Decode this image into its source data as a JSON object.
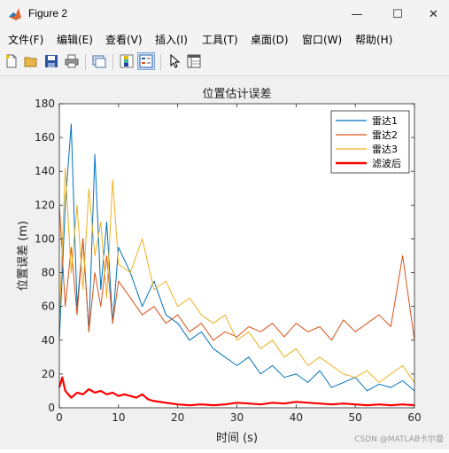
{
  "window": {
    "title": "Figure 2",
    "minimize": "—",
    "maximize": "☐",
    "close": "✕"
  },
  "menu": [
    "文件(F)",
    "编辑(E)",
    "查看(V)",
    "插入(I)",
    "工具(T)",
    "桌面(D)",
    "窗口(W)",
    "帮助(H)"
  ],
  "toolbar": [
    "new-figure-icon",
    "open-file-icon",
    "save-icon",
    "print-icon",
    "link-plot-icon",
    "colorbar-icon",
    "legend-icon",
    "pointer-icon",
    "property-inspector-icon"
  ],
  "watermark": "CSDN @MATLAB卡尔曼",
  "chart_data": {
    "type": "line",
    "title": "位置估计误差",
    "xlabel": "时间 (s)",
    "ylabel": "位置误差 (m)",
    "xlim": [
      0,
      60
    ],
    "ylim": [
      0,
      180
    ],
    "xticks": [
      0,
      10,
      20,
      30,
      40,
      50,
      60
    ],
    "yticks": [
      0,
      20,
      40,
      60,
      80,
      100,
      120,
      140,
      160,
      180
    ],
    "grid": false,
    "legend_position": "top-right",
    "series": [
      {
        "name": "雷达1",
        "color": "#0072BD",
        "x": [
          0,
          1,
          2,
          3,
          4,
          5,
          6,
          7,
          8,
          9,
          10,
          12,
          14,
          16,
          18,
          20,
          22,
          24,
          26,
          28,
          30,
          32,
          34,
          36,
          38,
          40,
          42,
          44,
          46,
          48,
          50,
          52,
          54,
          56,
          58,
          60
        ],
        "y": [
          40,
          120,
          168,
          60,
          100,
          45,
          150,
          70,
          110,
          50,
          95,
          80,
          60,
          75,
          55,
          50,
          40,
          45,
          35,
          30,
          25,
          30,
          20,
          25,
          18,
          20,
          15,
          22,
          12,
          15,
          18,
          10,
          14,
          12,
          16,
          10
        ]
      },
      {
        "name": "雷达2",
        "color": "#D95319",
        "x": [
          0,
          1,
          2,
          3,
          4,
          5,
          6,
          7,
          8,
          9,
          10,
          12,
          14,
          16,
          18,
          20,
          22,
          24,
          26,
          28,
          30,
          32,
          34,
          36,
          38,
          40,
          42,
          44,
          46,
          48,
          50,
          52,
          54,
          56,
          58,
          60
        ],
        "y": [
          120,
          60,
          95,
          55,
          100,
          45,
          80,
          60,
          90,
          50,
          75,
          65,
          55,
          60,
          50,
          55,
          45,
          50,
          40,
          45,
          42,
          48,
          45,
          50,
          42,
          50,
          45,
          48,
          40,
          52,
          45,
          50,
          55,
          48,
          90,
          40
        ]
      },
      {
        "name": "雷达3",
        "color": "#EDB120",
        "x": [
          0,
          1,
          2,
          3,
          4,
          5,
          6,
          7,
          8,
          9,
          10,
          12,
          14,
          16,
          18,
          20,
          22,
          24,
          26,
          28,
          30,
          32,
          34,
          36,
          38,
          40,
          42,
          44,
          46,
          48,
          50,
          52,
          54,
          56,
          58,
          60
        ],
        "y": [
          50,
          142,
          80,
          120,
          70,
          130,
          90,
          110,
          65,
          135,
          85,
          80,
          100,
          70,
          75,
          60,
          65,
          55,
          50,
          55,
          40,
          45,
          35,
          40,
          30,
          35,
          25,
          30,
          25,
          20,
          18,
          22,
          15,
          20,
          25,
          15
        ]
      },
      {
        "name": "滤波后",
        "color": "#FF0000",
        "x": [
          0,
          0.5,
          1,
          2,
          3,
          4,
          5,
          6,
          7,
          8,
          9,
          10,
          11,
          12,
          13,
          14,
          15,
          16,
          18,
          20,
          22,
          24,
          26,
          28,
          30,
          32,
          34,
          36,
          38,
          40,
          42,
          44,
          46,
          48,
          50,
          52,
          54,
          56,
          58,
          60
        ],
        "y": [
          12,
          18,
          10,
          6,
          9,
          8,
          11,
          9,
          10,
          8,
          9,
          7,
          8,
          7,
          6,
          8,
          5,
          4,
          3,
          2,
          1.5,
          2,
          1.5,
          2,
          3,
          2.5,
          2,
          3,
          2.5,
          3.5,
          3,
          2.5,
          2,
          2.5,
          2,
          1.5,
          2,
          1.5,
          2,
          1.5
        ]
      }
    ]
  }
}
